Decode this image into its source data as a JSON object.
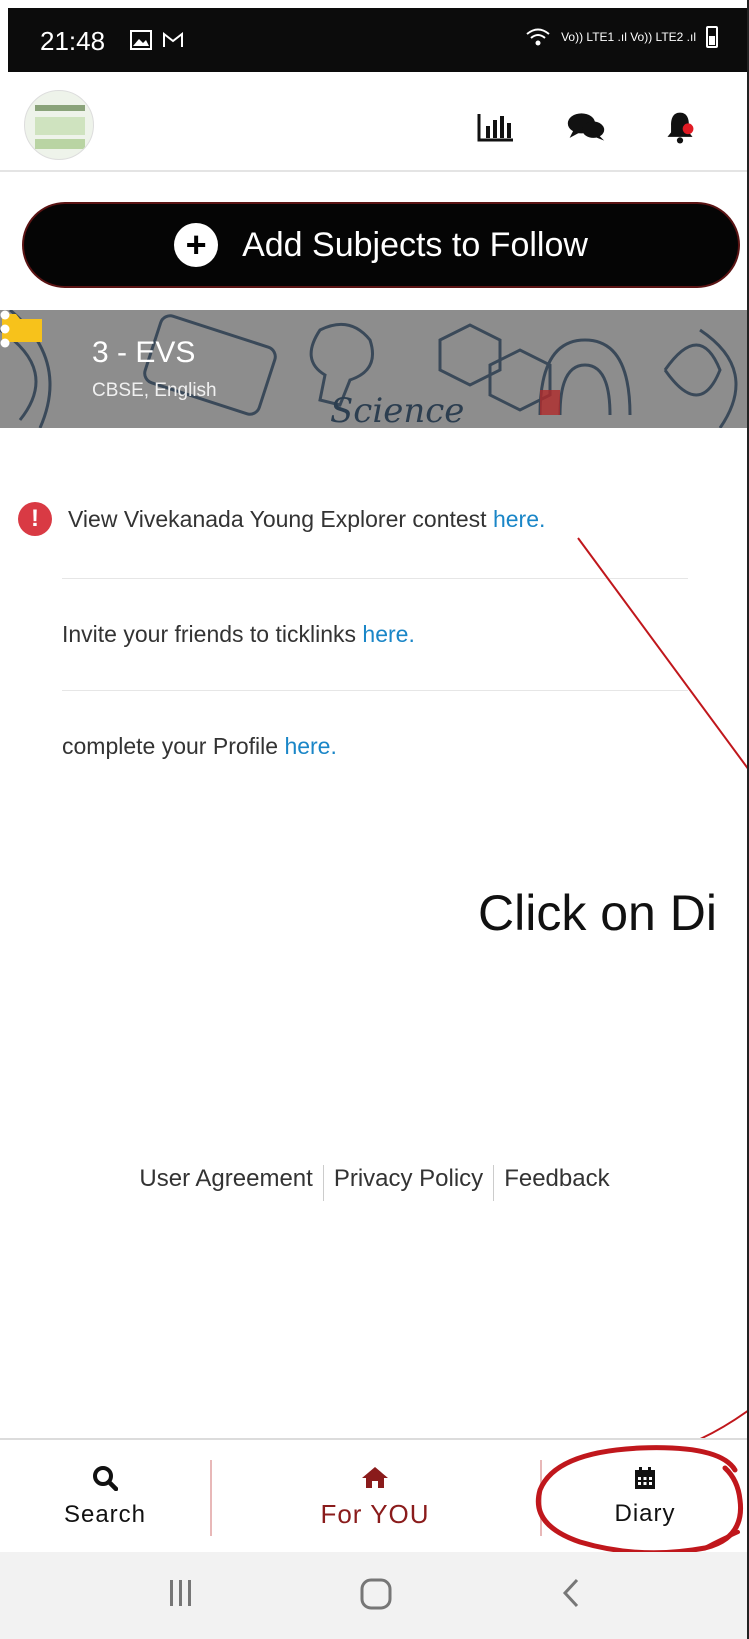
{
  "status_bar": {
    "time": "21:48",
    "signal_text": "Vo)) LTE1 .ıl Vo)) LTE2 .ıl"
  },
  "header": {
    "icons": [
      "chart-icon",
      "chat-icon",
      "bell-icon"
    ]
  },
  "add_subjects": {
    "label": "Add Subjects to Follow"
  },
  "subject": {
    "title": "3 - EVS",
    "subtitle": "CBSE, English"
  },
  "notices": [
    {
      "text": "View Vivekanada Young Explorer contest ",
      "link": "here."
    },
    {
      "text": "Invite your friends to ticklinks ",
      "link": "here."
    },
    {
      "text": "complete your Profile ",
      "link": "here."
    }
  ],
  "annotation": {
    "text": "Click on Di"
  },
  "footer": {
    "links": [
      "User Agreement",
      "Privacy Policy",
      "Feedback"
    ]
  },
  "bottom_nav": [
    {
      "label": "Search",
      "icon": "search-icon"
    },
    {
      "label": "For YOU",
      "icon": "home-icon"
    },
    {
      "label": "Diary",
      "icon": "calendar-icon"
    }
  ],
  "colors": {
    "accent": "#8a1b1b",
    "link": "#1a86c7",
    "alert": "#d93a44",
    "annotation": "#c0171c"
  }
}
